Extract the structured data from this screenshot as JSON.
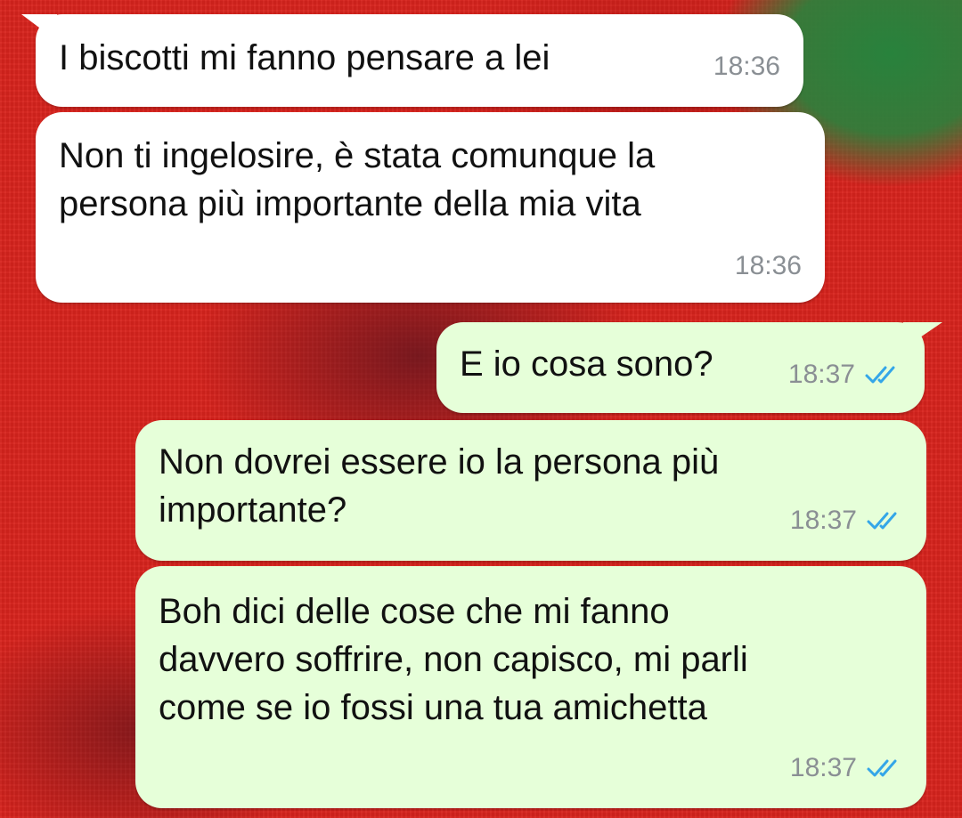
{
  "chat": {
    "messages": [
      {
        "direction": "incoming",
        "text": "I biscotti mi fanno pensare a lei",
        "time": "18:36"
      },
      {
        "direction": "incoming",
        "text": "Non ti ingelosire, è stata comunque la\npersona più importante della mia vita",
        "time": "18:36"
      },
      {
        "direction": "outgoing",
        "text": "E io cosa sono?",
        "time": "18:37",
        "status": "read"
      },
      {
        "direction": "outgoing",
        "text": "Non dovrei essere io la persona più\nimportante?",
        "time": "18:37",
        "status": "read"
      },
      {
        "direction": "outgoing",
        "text": "Boh dici delle cose che mi fanno\ndavvero soffrire, non capisco, mi parli\ncome se io fossi una tua amichetta",
        "time": "18:37",
        "status": "read"
      }
    ]
  },
  "colors": {
    "incoming_bubble": "#ffffff",
    "outgoing_bubble": "#e6ffd9",
    "read_ticks": "#34a6e8",
    "time_text": "#8a8f94",
    "wallpaper_red": "#d8231d",
    "wallpaper_green": "#28823c"
  },
  "icons": {
    "read_status": "double-check-icon"
  }
}
